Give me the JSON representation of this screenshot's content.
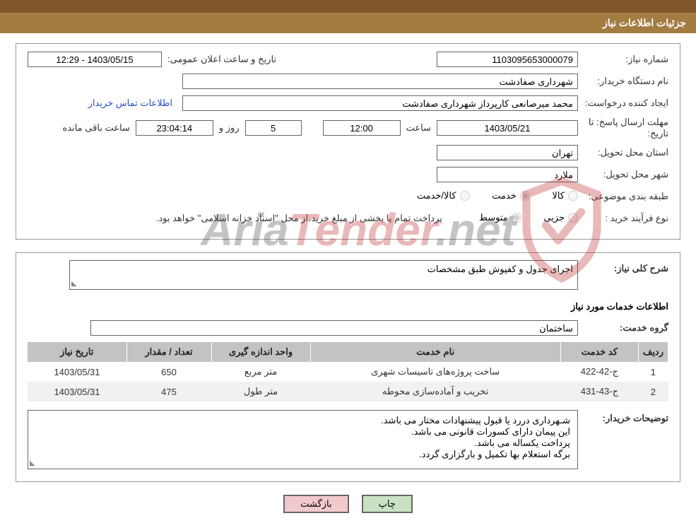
{
  "title": "جزئیات اطلاعات نیاز",
  "labels": {
    "need_no": "شماره نیاز:",
    "announce_dt": "تاریخ و ساعت اعلان عمومی:",
    "buyer_org": "نام دستگاه خریدار:",
    "requester": "ایجاد کننده درخواست:",
    "contact_link": "اطلاعات تماس خریدار",
    "deadline": "مهلت ارسال پاسخ: تا تاریخ:",
    "time_word": "ساعت",
    "day_and": "روز و",
    "hours_remain": "ساعت باقی مانده",
    "province": "استان محل تحویل:",
    "city": "شهر محل تحویل:",
    "category": "طبقه بندی موضوعی:",
    "purchase_type": "نوع فرآیند خرید  :",
    "overall_desc": "شرح کلی نیاز:",
    "services_info": "اطلاعات خدمات مورد نیاز",
    "service_group": "گروه خدمت:",
    "buyer_notes": "توضیحات خریدار:",
    "print": "چاپ",
    "back": "بازگشت",
    "payment_note": "پرداخت تمام یا بخشی از مبلغ خرید،از محل \"اسناد خزانه اسلامی\" خواهد بود."
  },
  "fields": {
    "need_no": "1103095653000079",
    "announce_dt": "1403/05/15 - 12:29",
    "buyer_org": "شهرداری صفادشت",
    "requester": "محمد میرصانعی کارپرداز شهرداری صفادشت",
    "deadline_date": "1403/05/21",
    "deadline_time": "12:00",
    "days_left": "5",
    "countdown": "23:04:14",
    "province": "تهران",
    "city": "ملارد",
    "overall_desc": "اجرای جدول و کفپوش طبق مشخصات",
    "service_group": "ساختمان"
  },
  "radios": {
    "cat_goods": "کالا",
    "cat_service": "خدمت",
    "cat_both": "کالا/خدمت",
    "pt_small": "جزیی",
    "pt_medium": "متوسط"
  },
  "table": {
    "headers": {
      "idx": "ردیف",
      "code": "کد خدمت",
      "name": "نام خدمت",
      "unit": "واحد اندازه گیری",
      "qty": "تعداد / مقدار",
      "date": "تاریخ نیاز"
    },
    "rows": [
      {
        "idx": "1",
        "code": "ج-42-422",
        "name": "ساخت پروژه‌های تاسیسات شهری",
        "unit": "متر مربع",
        "qty": "650",
        "date": "1403/05/31"
      },
      {
        "idx": "2",
        "code": "ج-43-431",
        "name": "تخریب و آماده‌سازی محوطه",
        "unit": "متر طول",
        "qty": "475",
        "date": "1403/05/31"
      }
    ]
  },
  "notes": [
    "شـهرداری دررد یا قبول پیشنهادات مختار می باشد.",
    "این پیمان دارای کسورات قانونی می باشد.",
    "پرداخت یکساله می باشد.",
    "برگه استعلام بها تکمیل و بارگزاری گردد."
  ],
  "watermark": {
    "aria": "Aria",
    "tender": "Tender",
    "net": ".net"
  }
}
